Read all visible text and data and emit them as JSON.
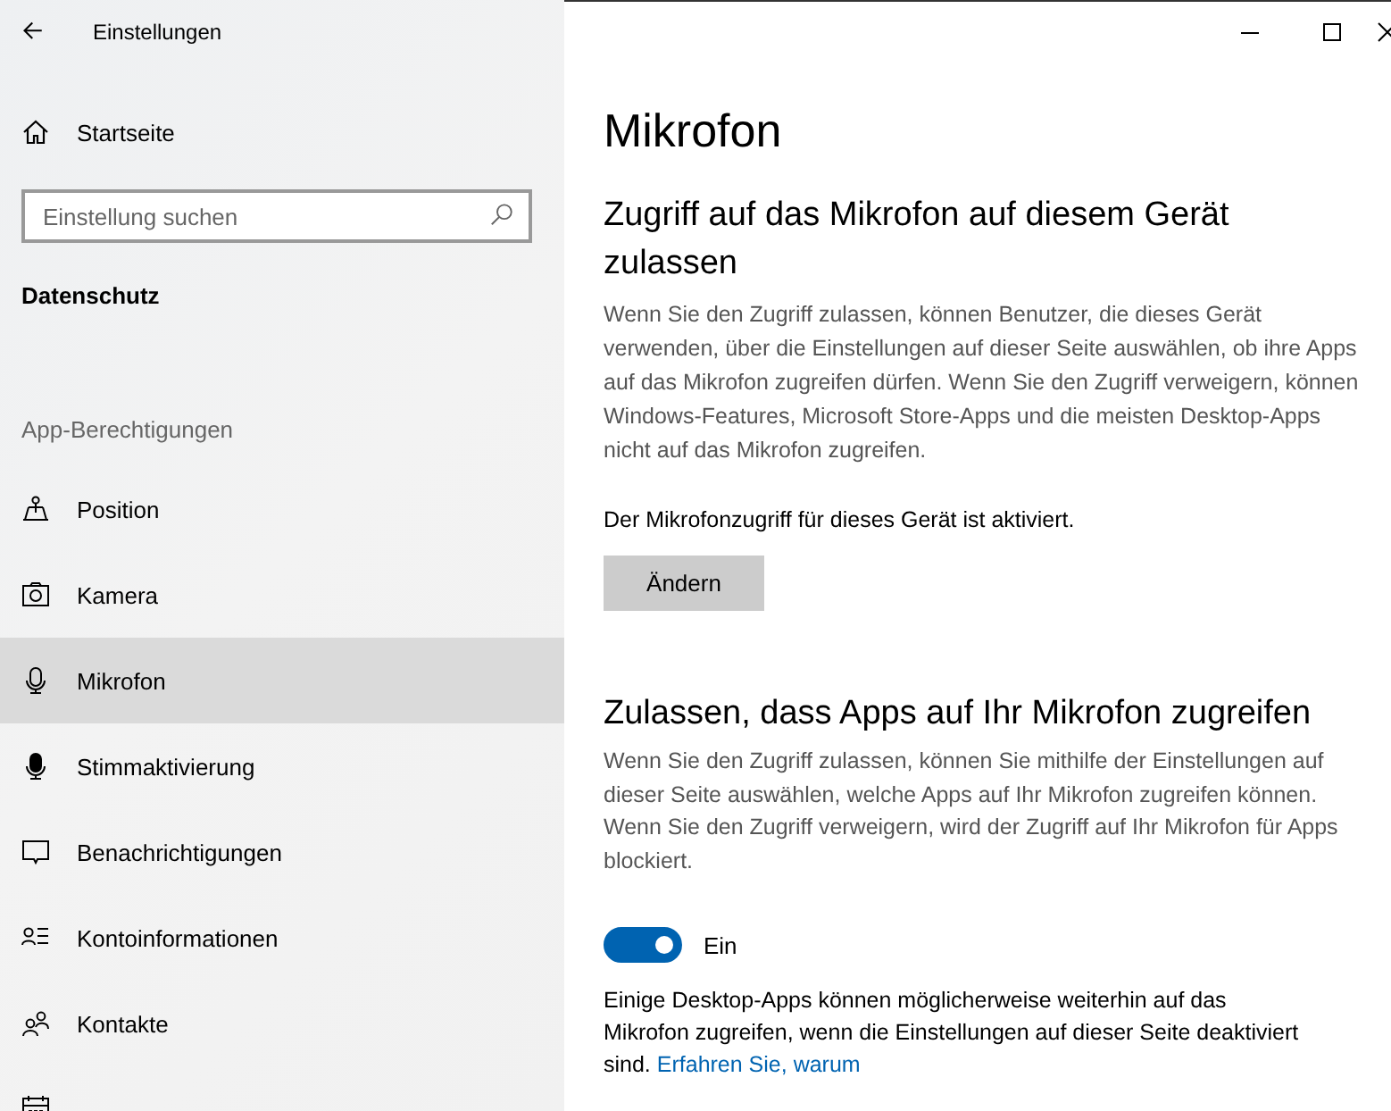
{
  "window": {
    "title": "Einstellungen"
  },
  "sidebar": {
    "home": "Startseite",
    "search": {
      "placeholder": "Einstellung suchen"
    },
    "section": "Datenschutz",
    "group": "App-Berechtigungen",
    "items": [
      {
        "kind": "position",
        "label": "Position",
        "selected": false
      },
      {
        "kind": "camera",
        "label": "Kamera",
        "selected": false
      },
      {
        "kind": "microphone",
        "label": "Mikrofon",
        "selected": true
      },
      {
        "kind": "voice",
        "label": "Stimmaktivierung",
        "selected": false
      },
      {
        "kind": "notification",
        "label": "Benachrichtigungen",
        "selected": false
      },
      {
        "kind": "account",
        "label": "Kontoinformationen",
        "selected": false
      },
      {
        "kind": "contacts",
        "label": "Kontakte",
        "selected": false
      },
      {
        "kind": "calendar",
        "selected": false
      }
    ]
  },
  "content": {
    "title": "Mikrofon",
    "sections": [
      {
        "heading": "Zugriff auf das Mikrofon auf diesem Gerät zulassen",
        "description": "Wenn Sie den Zugriff zulassen, können Benutzer, die dieses Gerät verwenden, über die Einstellungen auf dieser Seite auswählen, ob ihre Apps auf das Mikrofon zugreifen dürfen. Wenn Sie den Zugriff verweigern, können Windows-Features, Microsoft Store-Apps und die meisten Desktop-Apps nicht auf das Mikrofon zugreifen.",
        "status": "Der Mikrofonzugriff für dieses Gerät ist aktiviert.",
        "button": "Ändern"
      },
      {
        "heading": "Zulassen, dass Apps auf Ihr Mikrofon zugreifen",
        "description": "Wenn Sie den Zugriff zulassen, können Sie mithilfe der Einstellungen auf dieser Seite auswählen, welche Apps auf Ihr Mikrofon zugreifen können. Wenn Sie den Zugriff verweigern, wird der Zugriff auf Ihr Mikrofon für Apps blockiert.",
        "toggle": {
          "on": true,
          "label": "Ein"
        },
        "note": "Einige Desktop-Apps können möglicherweise weiterhin auf das Mikrofon zugreifen, wenn die Einstellungen auf dieser Seite deaktiviert sind.",
        "link": "Erfahren Sie, warum"
      }
    ]
  }
}
